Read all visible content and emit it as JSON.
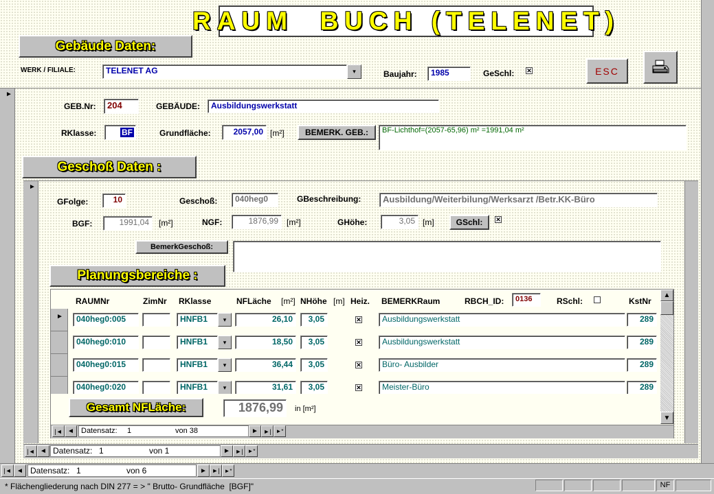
{
  "title": "RAUM  BUCH (TELENET)",
  "gebaeude": {
    "section_label": "Gebäude Daten:",
    "werk_label": "WERK / FILIALE:",
    "werk_value": "TELENET AG",
    "baujahr_label": "Baujahr:",
    "baujahr_value": "1985",
    "geschl_label": "GeSchl:",
    "geschl_checked": "✕",
    "esc_label": "ESC",
    "gebnr_label": "GEB.Nr:",
    "gebnr_value": "204",
    "gebaeude_label": "GEBÄUDE:",
    "gebaeude_value": "Ausbildungswerkstatt",
    "rklasse_label": "RKlasse:",
    "rklasse_value": "BF",
    "grundflaeche_label": "Grundfläche:",
    "grundflaeche_value": "2057,00",
    "grundflaeche_unit": "[m²]",
    "bemerk_btn": "BEMERK. GEB.:",
    "bemerk_value": "BF-Lichthof=(2057-65,96) m² =1991,04 m²"
  },
  "geschoss": {
    "section_label": "Geschoß Daten :",
    "gfolge_label": "GFolge:",
    "gfolge_value": "10",
    "geschoss_label": "Geschoß:",
    "geschoss_value": "040heg0",
    "gbeschr_label": "GBeschreibung:",
    "gbeschr_value": "Ausbildung/Weiterbilung/Werksarzt /Betr.KK-Büro",
    "bgf_label": "BGF:",
    "bgf_value": "1991,04",
    "bgf_unit": "[m²]",
    "ngf_label": "NGF:",
    "ngf_value": "1876,99",
    "ngf_unit": "[m²]",
    "ghoehe_label": "GHöhe:",
    "ghoehe_value": "3,05",
    "ghoehe_unit": "[m]",
    "gschl_btn": "GSchl:",
    "gschl_checked": "✕",
    "bemerk_btn": "BemerkGeschoß:"
  },
  "planung": {
    "section_label": "Planungsbereiche :",
    "headers": {
      "raumnr": "RAUMNr",
      "zimnr": "ZimNr",
      "rklasse": "RKlasse",
      "nflaeche": "NFLäche",
      "nflaeche_unit": "[m²]",
      "nhoehe": "NHöhe",
      "nhoehe_unit": "[m]",
      "heiz": "Heiz.",
      "bemerk": "BEMERKRaum",
      "rbch_label": "RBCH_ID:",
      "rbch_value": "0136",
      "rschl_label": "RSchl:",
      "kstnr": "KstNr"
    },
    "rows": [
      {
        "raumnr": "040heg0:005",
        "zimnr": "",
        "rklasse": "HNFB1",
        "nflaeche": "26,10",
        "nhoehe": "3,05",
        "heiz": "✕",
        "bemerk": "Ausbildungswerkstatt",
        "kstnr": "289"
      },
      {
        "raumnr": "040heg0:010",
        "zimnr": "",
        "rklasse": "HNFB1",
        "nflaeche": "18,50",
        "nhoehe": "3,05",
        "heiz": "✕",
        "bemerk": "Ausbildungswerkstatt",
        "kstnr": "289"
      },
      {
        "raumnr": "040heg0:015",
        "zimnr": "",
        "rklasse": "HNFB1",
        "nflaeche": "36,44",
        "nhoehe": "3,05",
        "heiz": "✕",
        "bemerk": "Büro- Ausbilder",
        "kstnr": "289"
      },
      {
        "raumnr": "040heg0:020",
        "zimnr": "",
        "rklasse": "HNFB1",
        "nflaeche": "31,61",
        "nhoehe": "3,05",
        "heiz": "✕",
        "bemerk": "Meister-Büro",
        "kstnr": "289"
      }
    ],
    "gesamt_btn": "Gesamt NFLäche:",
    "gesamt_value": "1876,99",
    "gesamt_unit": "in [m²]"
  },
  "nav_inner": {
    "label": "Datensatz:",
    "current": "1",
    "of": "von 38"
  },
  "nav_middle": {
    "label": "Datensatz:",
    "current": "1",
    "of": "von 1"
  },
  "nav_outer": {
    "label": "Datensatz:",
    "current": "1",
    "of": "von 6"
  },
  "status": {
    "text": "* Flächengliederung nach DIN 277 = > \" Brutto- Grundfläche  [BGF]\"",
    "nf": "NF"
  },
  "icons": {
    "combo": "▾",
    "first": "|◄",
    "prev": "◄",
    "next": "►",
    "last": "►|",
    "new": "►*",
    "up": "▲",
    "down": "▼",
    "record": "►"
  }
}
